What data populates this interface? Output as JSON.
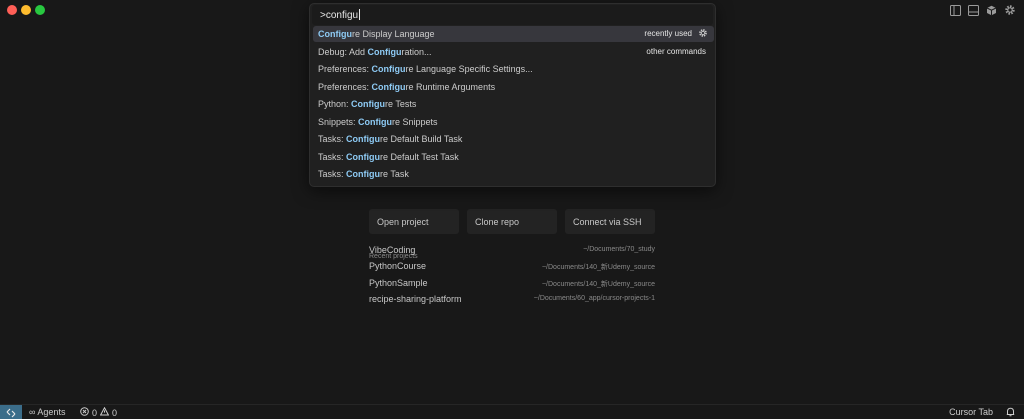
{
  "palette": {
    "query": ">configu",
    "items": [
      {
        "highlight": "Configu",
        "rest": "re Display Language",
        "prefix": "",
        "right": "recently used",
        "selected": true
      },
      {
        "prefix": "Debug: Add ",
        "highlight": "Configu",
        "rest": "ration...",
        "right": "other commands"
      },
      {
        "prefix": "Preferences: ",
        "highlight": "Configu",
        "rest": "re Language Specific Settings..."
      },
      {
        "prefix": "Preferences: ",
        "highlight": "Configu",
        "rest": "re Runtime Arguments"
      },
      {
        "prefix": "Python: ",
        "highlight": "Configu",
        "rest": "re Tests"
      },
      {
        "prefix": "Snippets: ",
        "highlight": "Configu",
        "rest": "re Snippets"
      },
      {
        "prefix": "Tasks: ",
        "highlight": "Configu",
        "rest": "re Default Build Task"
      },
      {
        "prefix": "Tasks: ",
        "highlight": "Configu",
        "rest": "re Default Test Task"
      },
      {
        "prefix": "Tasks: ",
        "highlight": "Configu",
        "rest": "re Task"
      }
    ]
  },
  "welcome": {
    "actions": [
      "Open project",
      "Clone repo",
      "Connect via SSH"
    ],
    "recent_title": "Recent projects",
    "recent": [
      {
        "name": "VibeCoding",
        "path": "~/Documents/70_study"
      },
      {
        "name": "PythonCourse",
        "path": "~/Documents/140_新Udemy_source"
      },
      {
        "name": "PythonSample",
        "path": "~/Documents/140_新Udemy_source"
      },
      {
        "name": "recipe-sharing-platform",
        "path": "~/Documents/60_app/cursor-projects-1"
      }
    ]
  },
  "statusbar": {
    "agents": "∞ Agents",
    "errors": "0",
    "warnings": "0",
    "cursor_tab": "Cursor Tab"
  },
  "icons": [
    "sidebar-left-icon",
    "panel-bottom-icon",
    "cube-icon",
    "gear-icon",
    "remote-icon",
    "error-icon",
    "warning-icon",
    "bell-icon"
  ],
  "colors": {
    "highlight": "#8ecbf5",
    "remote": "#3b6d8a",
    "selected": "#37373d"
  }
}
